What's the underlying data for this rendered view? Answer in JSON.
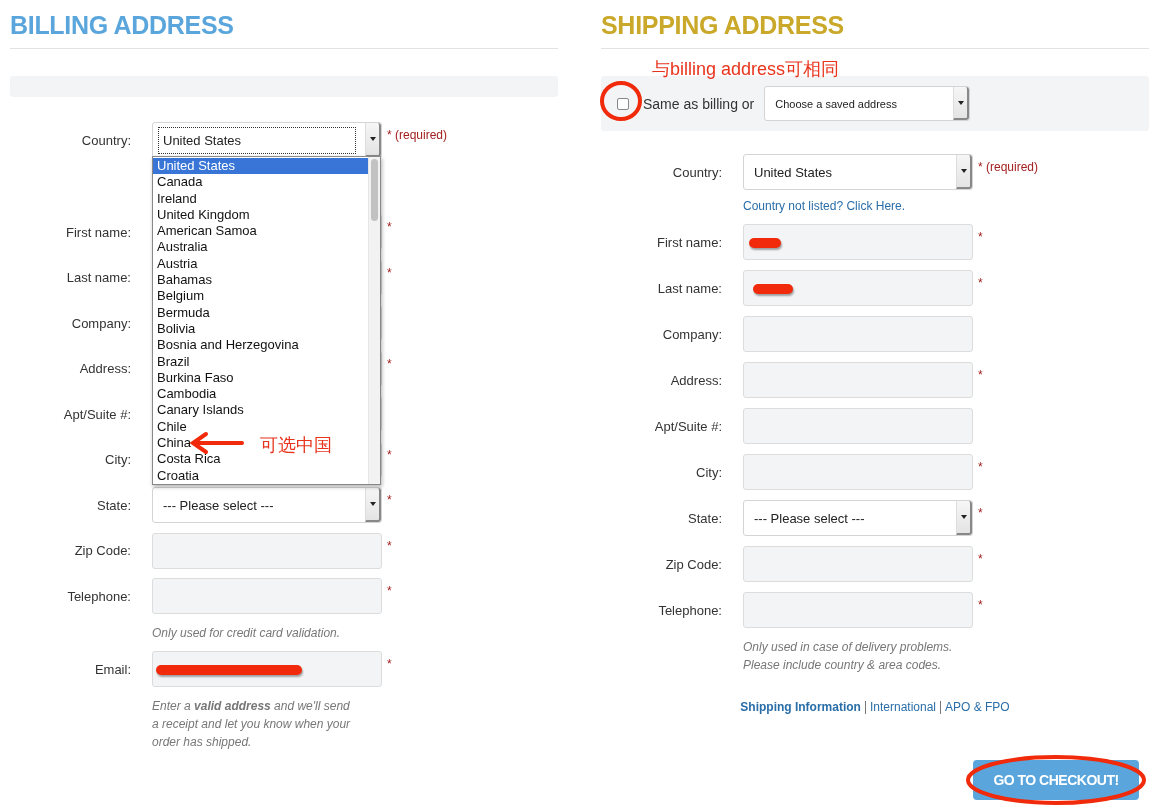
{
  "billing": {
    "title": "BILLING ADDRESS",
    "fields": [
      {
        "kind": "select",
        "label": "Country:",
        "value": "United States",
        "mark": "* (required)",
        "open": true,
        "options": [
          {
            "label": "United States",
            "selected": true
          },
          {
            "label": "Canada",
            "selected": false
          },
          {
            "label": "Ireland",
            "selected": false
          },
          {
            "label": "United Kingdom",
            "selected": false
          },
          {
            "label": "American Samoa",
            "selected": false
          },
          {
            "label": "Australia",
            "selected": false
          },
          {
            "label": "Austria",
            "selected": false
          },
          {
            "label": "Bahamas",
            "selected": false
          },
          {
            "label": "Belgium",
            "selected": false
          },
          {
            "label": "Bermuda",
            "selected": false
          },
          {
            "label": "Bolivia",
            "selected": false
          },
          {
            "label": "Bosnia and Herzegovina",
            "selected": false
          },
          {
            "label": "Brazil",
            "selected": false
          },
          {
            "label": "Burkina Faso",
            "selected": false
          },
          {
            "label": "Cambodia",
            "selected": false
          },
          {
            "label": "Canary Islands",
            "selected": false
          },
          {
            "label": "Chile",
            "selected": false
          },
          {
            "label": "China",
            "selected": false
          },
          {
            "label": "Costa Rica",
            "selected": false
          },
          {
            "label": "Croatia",
            "selected": false
          }
        ]
      },
      {
        "kind": "text",
        "label": "First name:",
        "mark": "*"
      },
      {
        "kind": "text",
        "label": "Last name:",
        "mark": "*"
      },
      {
        "kind": "text",
        "label": "Company:"
      },
      {
        "kind": "text",
        "label": "Address:",
        "mark": "*"
      },
      {
        "kind": "text",
        "label": "Apt/Suite #:"
      },
      {
        "kind": "text",
        "label": "City:",
        "mark": "*"
      },
      {
        "kind": "select",
        "label": "State:",
        "value": "--- Please select ---",
        "mark": "*",
        "open": false
      },
      {
        "kind": "text",
        "label": "Zip Code:",
        "mark": "*"
      },
      {
        "kind": "text",
        "label": "Telephone:",
        "mark": "*",
        "hint": [
          "Only used for credit card validation."
        ]
      },
      {
        "kind": "text",
        "label": "Email:",
        "mark": "*",
        "redacted": true,
        "hint": [
          "Enter a **valid address** and we'll send a receipt and let you know when your order has shipped."
        ]
      }
    ]
  },
  "shipping": {
    "title": "SHIPPING ADDRESS",
    "same_as_billing": {
      "label": "Same as billing or",
      "checked": false
    },
    "saved_address": {
      "value": "Choose a saved address"
    },
    "fields": [
      {
        "kind": "select",
        "label": "Country:",
        "value": "United States",
        "mark": "* (required)",
        "open": false,
        "link": "Country not listed? Click Here."
      },
      {
        "kind": "text",
        "label": "First name:",
        "mark": "*",
        "redacted": true
      },
      {
        "kind": "text",
        "label": "Last name:",
        "mark": "*",
        "redacted": true
      },
      {
        "kind": "text",
        "label": "Company:"
      },
      {
        "kind": "text",
        "label": "Address:",
        "mark": "*"
      },
      {
        "kind": "text",
        "label": "Apt/Suite #:"
      },
      {
        "kind": "text",
        "label": "City:",
        "mark": "*"
      },
      {
        "kind": "select",
        "label": "State:",
        "value": "--- Please select ---",
        "mark": "*",
        "open": false
      },
      {
        "kind": "text",
        "label": "Zip Code:",
        "mark": "*"
      },
      {
        "kind": "text",
        "label": "Telephone:",
        "mark": "*",
        "hint": [
          "Only used in case of delivery problems.",
          "Please include country & area codes."
        ]
      }
    ],
    "links": [
      {
        "label": "Shipping Information",
        "bold": true
      },
      {
        "label": "International",
        "bold": false
      },
      {
        "label": "APO & FPO",
        "bold": false
      }
    ],
    "checkout_button": "GO TO CHECKOUT!"
  },
  "annotations": {
    "dropdown_note": "可选中国",
    "checkbox_note": "与billing address可相同"
  }
}
